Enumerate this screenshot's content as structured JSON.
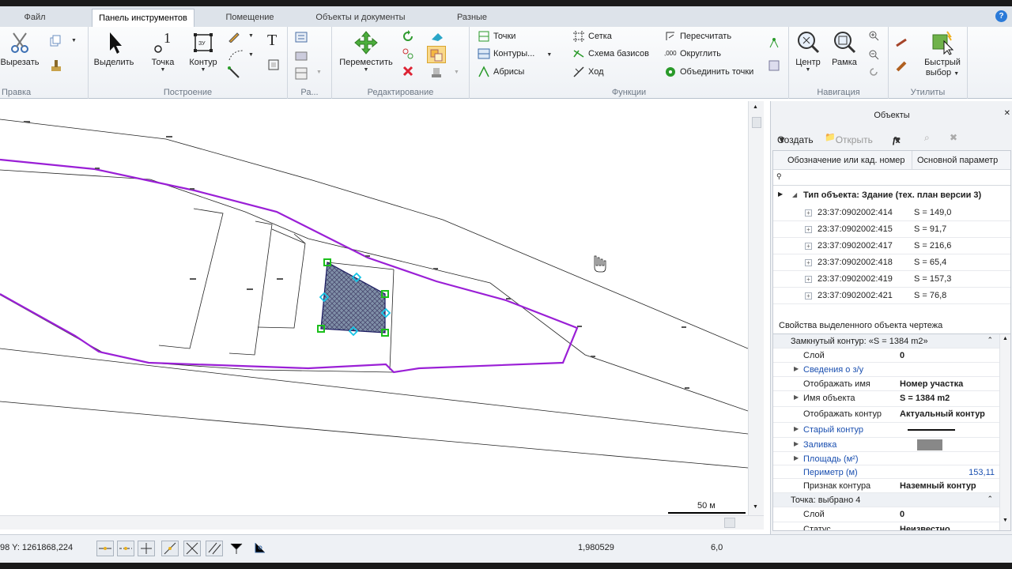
{
  "tabs": [
    "Файл",
    "Панель инструментов",
    "Помещение",
    "Объекты и документы",
    "Разные"
  ],
  "ribbon": {
    "groups": [
      "Правка",
      "Построение",
      "Ра...",
      "Редактирование",
      "Функции",
      "Навигация",
      "Утилиты"
    ],
    "cut": "Вырезать",
    "select": "Выделить",
    "point": "Точка",
    "contour": "Контур",
    "move": "Переместить",
    "f_points": "Точки",
    "f_contours": "Контуры...",
    "f_abrisy": "Абрисы",
    "f_grid": "Сетка",
    "f_basis": "Схема базисов",
    "f_hod": "Ход",
    "f_recalc": "Пересчитать",
    "f_round": "Округлить",
    "f_merge": "Объединить точки",
    "center": "Центр",
    "frame": "Рамка",
    "quick1": "Быстрый",
    "quick2": "выбор",
    "zu": "ЗУ",
    "round_ico": ",000"
  },
  "canvas": {
    "scale_label": "50 м"
  },
  "objects_panel": {
    "title": "Объекты",
    "create": "Создать",
    "open": "Открыть",
    "fx": "fx",
    "col1": "Обозначение или кад. номер",
    "col2": "Основной параметр",
    "group_label": "Тип объекта: Здание (тех. план версии 3)",
    "rows": [
      {
        "id": "23:37:0902002:414",
        "param": "S = 149,0"
      },
      {
        "id": "23:37:0902002:415",
        "param": "S = 91,7"
      },
      {
        "id": "23:37:0902002:417",
        "param": "S = 216,6"
      },
      {
        "id": "23:37:0902002:418",
        "param": "S = 65,4"
      },
      {
        "id": "23:37:0902002:419",
        "param": "S = 157,3"
      },
      {
        "id": "23:37:0902002:421",
        "param": "S = 76,8"
      }
    ]
  },
  "props_panel": {
    "title": "Свойства выделенного объекта чертежа",
    "header1": "Замкнутый контур: «S = 1384 m2»",
    "rows": [
      {
        "name": "Слой",
        "value": "0"
      },
      {
        "name": "Сведения о з/у",
        "value": ""
      },
      {
        "name": "Отображать имя",
        "value": "Номер участка"
      },
      {
        "name": "Имя объекта",
        "value": "S = 1384 m2"
      },
      {
        "name": "Отображать контур",
        "value": "Актуальный контур"
      },
      {
        "name": "Старый контур",
        "value": ""
      },
      {
        "name": "Заливка",
        "value": ""
      },
      {
        "name": "Площадь (м²)",
        "value": ""
      },
      {
        "name": "Периметр (м)",
        "value": "153,11"
      },
      {
        "name": "Признак контура",
        "value": "Наземный контур"
      }
    ],
    "header2": "Точка: выбрано 4",
    "rows2": [
      {
        "name": "Слой",
        "value": "0"
      },
      {
        "name": "Статус",
        "value": "Неизвестно"
      }
    ]
  },
  "status": {
    "coords": "98 Y: 1261868,224",
    "value1": "1,980529",
    "value2": "6,0"
  },
  "colors": {
    "accent_purple": "#9a1fd6",
    "selection_green": "#1bbf1b",
    "selection_cyan": "#14c4e6"
  }
}
